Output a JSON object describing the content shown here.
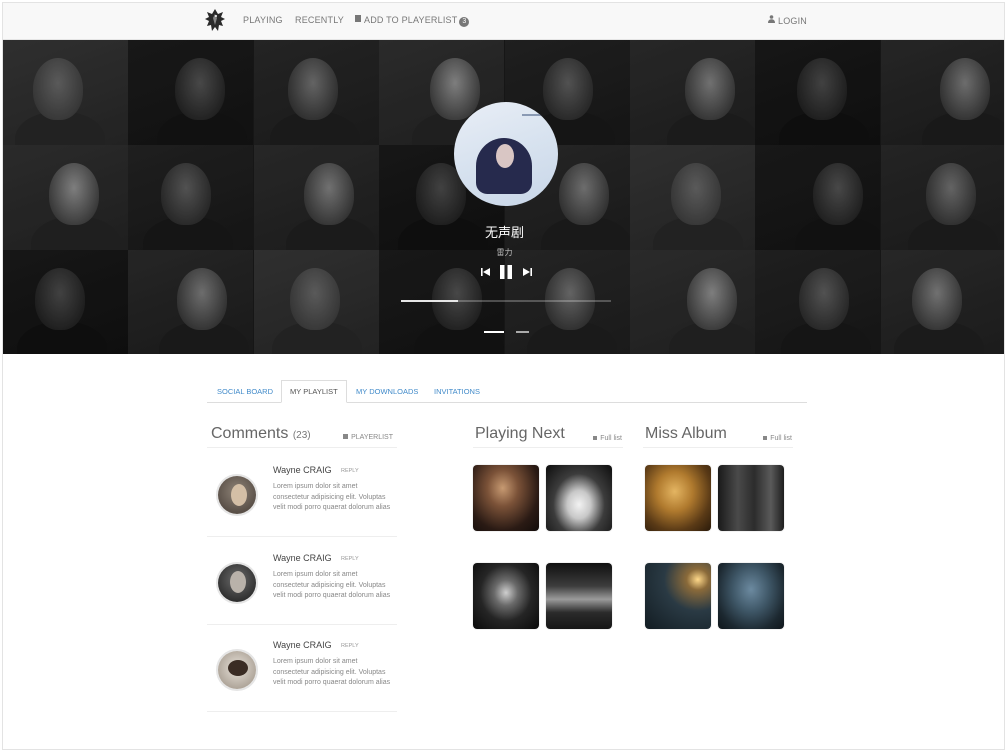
{
  "navbar": {
    "playing": "PLAYING",
    "recently": "RECENTLY",
    "add_to_playerlist": "ADD TO PLAYERLIST",
    "badge_count": "3",
    "login": "LOGIN",
    "logo_icon": "eagle-logo-icon"
  },
  "hero": {
    "song_title": "无声剧",
    "artist": "雷力",
    "progress": 0.27,
    "slide_count": 2,
    "active_slide": 1
  },
  "tabs": [
    {
      "label": "SOCIAL BOARD",
      "active": false
    },
    {
      "label": "MY PLAYLIST",
      "active": true
    },
    {
      "label": "MY DOWNLOADS",
      "active": false
    },
    {
      "label": "INVITATIONS",
      "active": false
    }
  ],
  "comments": {
    "title": "Comments",
    "count": "(23)",
    "playerlist_link": "PLAYERLIST",
    "items": [
      {
        "name": "Wayne CRAIG",
        "reply": "REPLY",
        "text": "Lorem ipsum dolor sit amet consectetur adipisicing elit. Voluptas velit modi porro quaerat dolorum alias"
      },
      {
        "name": "Wayne CRAIG",
        "reply": "REPLY",
        "text": "Lorem ipsum dolor sit amet consectetur adipisicing elit. Voluptas velit modi porro quaerat dolorum alias"
      },
      {
        "name": "Wayne CRAIG",
        "reply": "REPLY",
        "text": "Lorem ipsum dolor sit amet consectetur adipisicing elit. Voluptas velit modi porro quaerat dolorum alias"
      }
    ]
  },
  "playing_next": {
    "title": "Playing Next",
    "full_list": "Full list"
  },
  "miss_album": {
    "title": "Miss Album",
    "full_list": "Full list"
  },
  "colors": {
    "link_blue": "#428bca",
    "navbar_bg": "#f8f8f8",
    "hero_bg": "#1b1b1b"
  }
}
